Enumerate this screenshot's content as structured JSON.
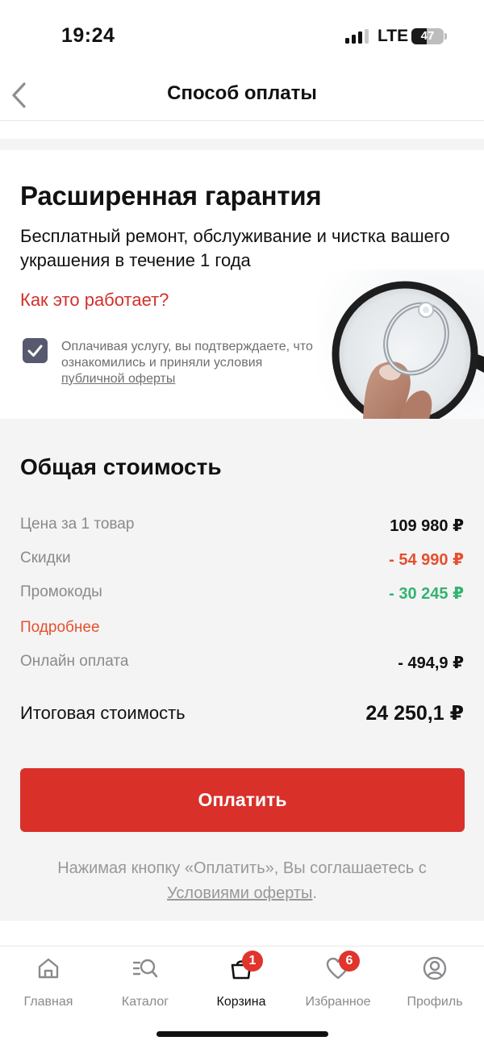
{
  "status_bar": {
    "time": "19:24",
    "network": "LTE",
    "battery": "47",
    "battery_level": 0.47
  },
  "header": {
    "title": "Способ оплаты",
    "back_icon": "chevron-left-icon"
  },
  "guarantee": {
    "title": "Расширенная гарантия",
    "description": "Бесплатный ремонт, обслуживание и чистка вашего украшения в течение 1 года",
    "link": "Как это работает?",
    "checkbox_checked": true,
    "consent_prefix": "Оплачивая услугу, вы подтверждаете, что ознакомились и приняли условия ",
    "consent_link": "публичной оферты",
    "image_icon": "magnifier-ring-image"
  },
  "total": {
    "title": "Общая стоимость",
    "rows": [
      {
        "label": "Цена за 1 товар",
        "value": "109 980 ₽"
      },
      {
        "label": "Скидки",
        "value": "- 54 990 ₽"
      },
      {
        "label": "Промокоды",
        "value": "- 30 245 ₽"
      },
      {
        "label": "Онлайн оплата",
        "value": "- 494,9 ₽"
      }
    ],
    "details_link": "Подробнее",
    "final_label": "Итоговая стоимость",
    "final_value": "24 250,1 ₽",
    "pay_button": "Оплатить",
    "terms_prefix": "Нажимая кнопку «Оплатить», Вы соглашаетесь с ",
    "terms_link": "Условиями оферты",
    "terms_suffix": "."
  },
  "colors": {
    "accent_red": "#d9302a",
    "discount_red": "#e4502f",
    "promo_green": "#33b370",
    "checkbox": "#575a6e"
  },
  "tabbar": {
    "items": [
      {
        "label": "Главная",
        "icon": "home-icon"
      },
      {
        "label": "Каталог",
        "icon": "catalog-search-icon"
      },
      {
        "label": "Корзина",
        "icon": "cart-icon",
        "badge": "1",
        "active": true
      },
      {
        "label": "Избранное",
        "icon": "heart-icon",
        "badge": "6"
      },
      {
        "label": "Профиль",
        "icon": "profile-icon"
      }
    ]
  }
}
